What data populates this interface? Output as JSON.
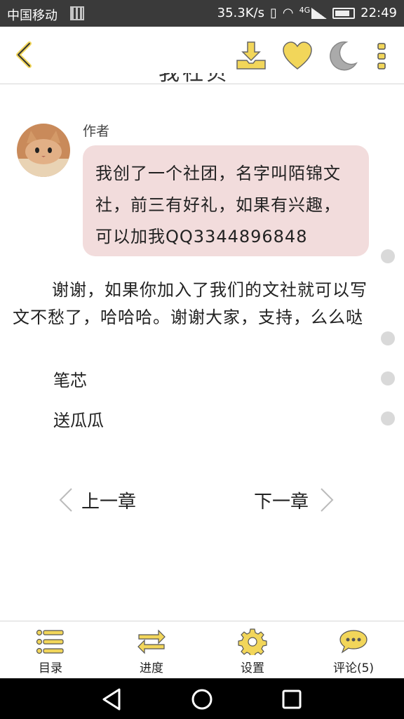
{
  "status_bar": {
    "carrier": "中国移动",
    "speed": "35.3K/s",
    "network": "4G",
    "time": "22:49"
  },
  "toolbar": {
    "cut_title": "我社贝"
  },
  "comment": {
    "author": "作者",
    "text": "我创了一个社团，名字叫陌锦文社，前三有好礼，如果有兴趣，可以加我QQ3344896848"
  },
  "paragraph": "谢谢，如果你加入了我们的文社就可以写文不愁了，哈哈哈。谢谢大家，支持，么么哒",
  "lines": [
    "笔芯",
    "送瓜瓜"
  ],
  "chapter_nav": {
    "prev": "上一章",
    "next": "下一章"
  },
  "tabs": [
    {
      "label": "目录",
      "icon": "list-icon"
    },
    {
      "label": "进度",
      "icon": "swap-arrows-icon"
    },
    {
      "label": "设置",
      "icon": "gear-icon"
    },
    {
      "label": "评论(5)",
      "icon": "chat-bubble-icon"
    }
  ],
  "colors": {
    "accent": "#f2d65a",
    "bubble": "#f2dcdc",
    "status_bar": "#3a3a3a"
  }
}
